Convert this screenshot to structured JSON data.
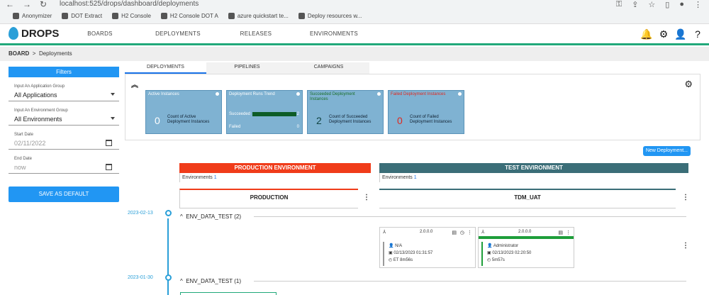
{
  "browser": {
    "url": "localhost:525/drops/dashboard/deployments",
    "bookmarks": [
      {
        "label": "Anonymizer"
      },
      {
        "label": "DOT Extract"
      },
      {
        "label": "H2 Console"
      },
      {
        "label": "H2 Console DOT A"
      },
      {
        "label": "azure quickstart te..."
      },
      {
        "label": "Deploy resources w..."
      }
    ]
  },
  "app": {
    "logo": "DROPS",
    "nav": [
      "BOARDS",
      "DEPLOYMENTS",
      "RELEASES",
      "ENVIRONMENTS"
    ]
  },
  "breadcrumb": {
    "root": "BOARD",
    "current": "Deployments"
  },
  "filters": {
    "title": "Filters",
    "app_group_label": "Input An Application Group",
    "app_group_value": "All Applications",
    "env_group_label": "Input An Environment Group",
    "env_group_value": "All Environments",
    "start_label": "Start Date",
    "start_value": "02/11/2022",
    "end_label": "End Date",
    "end_value": "now",
    "save_label": "SAVE AS DEFAULT"
  },
  "subtabs": [
    "DEPLOYMENTS",
    "PIPELINES",
    "CAMPAIGNS"
  ],
  "cards": {
    "active": {
      "title": "Active Instances",
      "num": "0",
      "desc": "Count of Active Deployment Instances"
    },
    "trend": {
      "title": "Deployment Runs Trend",
      "succeeded": "Succeeded",
      "failed": "Failed",
      "n1": "2",
      "n2": "0"
    },
    "succeeded": {
      "title": "Succeeded Deployment Instances",
      "num": "2",
      "desc": "Count of Succeeded Deployment Instances"
    },
    "failed": {
      "title": "Failed Deployment Instances",
      "num": "0",
      "desc": "Count of Failed Deployment Instances"
    }
  },
  "new_deployment_label": "New Deployment...",
  "env": {
    "prod_title": "PRODUCTION ENVIRONMENT",
    "test_title": "TEST ENVIRONMENT",
    "prod_sub_label": "Environments",
    "prod_sub_count": "1",
    "test_sub_label": "Environments",
    "test_sub_count": "1",
    "prod_stage": "PRODUCTION",
    "test_stage": "TDM_UAT"
  },
  "timeline": [
    {
      "date": "2023-02-13",
      "group": "ENV_DATA_TEST (2)"
    },
    {
      "date": "2023-01-30",
      "group": "ENV_DATA_TEST (1)"
    }
  ],
  "instances": [
    {
      "version": "2.0.0.0",
      "user": "N/A",
      "date": "02/13/2023 01:31:57",
      "duration": "ET 8m56s"
    },
    {
      "version": "2.0.0.0",
      "user": "Administrator",
      "date": "02/13/2023 02:20:50",
      "duration": "5m57s"
    }
  ]
}
